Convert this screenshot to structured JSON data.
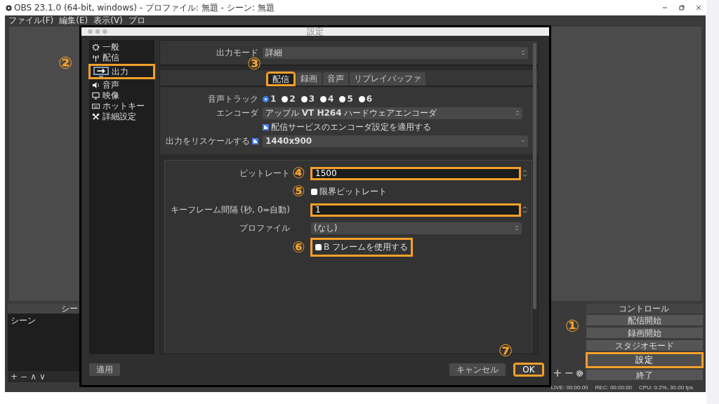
{
  "app_window": {
    "title": "OBS 23.1.0 (64-bit, windows) - プロファイル: 無題 - シーン: 無題",
    "menu": [
      "ファイル(F)",
      "編集(E)",
      "表示(V)",
      "プロ"
    ]
  },
  "scenes_dock": {
    "title": "シー",
    "items": [
      "シーン"
    ],
    "toolbar": [
      "+",
      "−",
      "∧",
      "∨"
    ]
  },
  "sources_toolbar": [
    "+",
    "−"
  ],
  "controls_dock": {
    "title": "コントロール",
    "buttons": [
      {
        "label": "配信開始",
        "highlighted": false
      },
      {
        "label": "録画開始",
        "highlighted": false
      },
      {
        "label": "スタジオモード",
        "highlighted": false
      },
      {
        "label": "設定",
        "highlighted": true,
        "callout": "①"
      },
      {
        "label": "終了",
        "highlighted": false
      }
    ]
  },
  "status_bar": [
    "LIVE: 00:00:00",
    "REC: 00:00:00",
    "CPU: 0.2%, 30.00 fps"
  ],
  "dialog": {
    "title": "設定",
    "sidebar": [
      {
        "label": "一般",
        "kind": "gear",
        "highlighted": false
      },
      {
        "label": "配信",
        "kind": "antenna",
        "highlighted": false
      },
      {
        "label": "出力",
        "kind": "output",
        "highlighted": true,
        "callout": "②"
      },
      {
        "label": "音声",
        "kind": "speaker",
        "highlighted": false
      },
      {
        "label": "映像",
        "kind": "monitor",
        "highlighted": false
      },
      {
        "label": "ホットキー",
        "kind": "keyboard",
        "highlighted": false
      },
      {
        "label": "詳細設定",
        "kind": "tools",
        "highlighted": false
      }
    ],
    "output_mode": {
      "label": "出力モード",
      "value": "詳細"
    },
    "tabs_callout": "③",
    "tabs": [
      {
        "label": "配信",
        "selected": true,
        "highlighted": true
      },
      {
        "label": "録画",
        "selected": false,
        "highlighted": false
      },
      {
        "label": "音声",
        "selected": false,
        "highlighted": false
      },
      {
        "label": "リプレイバッファ",
        "selected": false,
        "highlighted": false
      }
    ],
    "audio_track": {
      "label": "音声トラック",
      "options": [
        {
          "label": "1",
          "selected": true
        },
        {
          "label": "2",
          "selected": false
        },
        {
          "label": "3",
          "selected": false
        },
        {
          "label": "4",
          "selected": false
        },
        {
          "label": "5",
          "selected": false
        },
        {
          "label": "6",
          "selected": false
        }
      ]
    },
    "encoder": {
      "label": "エンコーダ",
      "value": "アップル **VT H264** ハードウェアエンコーダ"
    },
    "enforce_service": {
      "label": "配信サービスのエンコーダ設定を適用する",
      "checked": true
    },
    "rescale": {
      "label": "出力をリスケールする",
      "checked": true,
      "value": "1440x900"
    },
    "bitrate": {
      "label": "ビットレート",
      "value": "1500",
      "highlighted": true,
      "callout": "④"
    },
    "limit_bitrate": {
      "label": "限界ビットレート",
      "checked": false,
      "callout": "⑤"
    },
    "keyframe": {
      "label": "キーフレーム間隔 (秒, 0=自動)",
      "value": "1",
      "highlighted": true
    },
    "profile": {
      "label": "プロファイル",
      "value": "(なし)"
    },
    "bframes": {
      "label": "B フレームを使用する",
      "checked": false,
      "highlighted": true,
      "callout": "⑥"
    },
    "apply": "適用",
    "cancel": "キャンセル",
    "ok": {
      "label": "OK",
      "highlighted": true,
      "callout": "⑦"
    }
  }
}
